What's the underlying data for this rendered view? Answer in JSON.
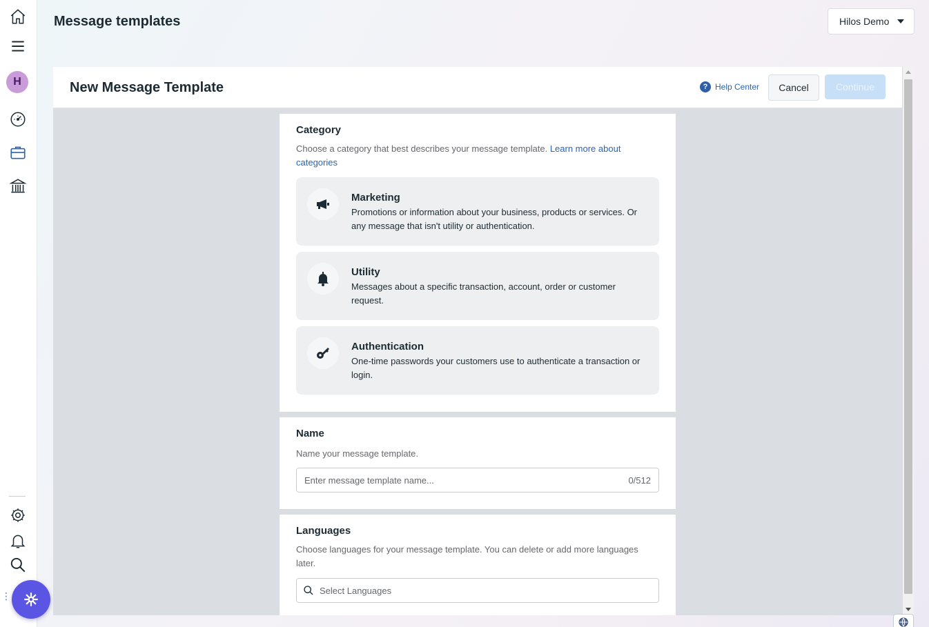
{
  "app": {
    "page_title": "Message templates"
  },
  "account": {
    "name": "Hilos Demo"
  },
  "rail": {
    "avatar_letter": "H"
  },
  "panel": {
    "title": "New Message Template",
    "help_label": "Help Center",
    "cancel_label": "Cancel",
    "continue_label": "Continue"
  },
  "category": {
    "heading": "Category",
    "description": "Choose a category that best describes your message template. ",
    "learn_more": "Learn more about categories",
    "options": [
      {
        "title": "Marketing",
        "text": "Promotions or information about your business, products or services. Or any message that isn't utility or authentication.",
        "icon": "megaphone-icon"
      },
      {
        "title": "Utility",
        "text": "Messages about a specific transaction, account, order or customer request.",
        "icon": "bell-icon"
      },
      {
        "title": "Authentication",
        "text": "One-time passwords your customers use to authenticate a transaction or login.",
        "icon": "key-icon"
      }
    ]
  },
  "name": {
    "heading": "Name",
    "description": "Name your message template.",
    "placeholder": "Enter message template name...",
    "counter": "0/512"
  },
  "languages": {
    "heading": "Languages",
    "description": "Choose languages for your message template. You can delete or add more languages later.",
    "placeholder": "Select Languages"
  },
  "colors": {
    "accent": "#2a63b0",
    "fab": "#5a55e3",
    "continue_disabled": "#c8e0f7"
  }
}
